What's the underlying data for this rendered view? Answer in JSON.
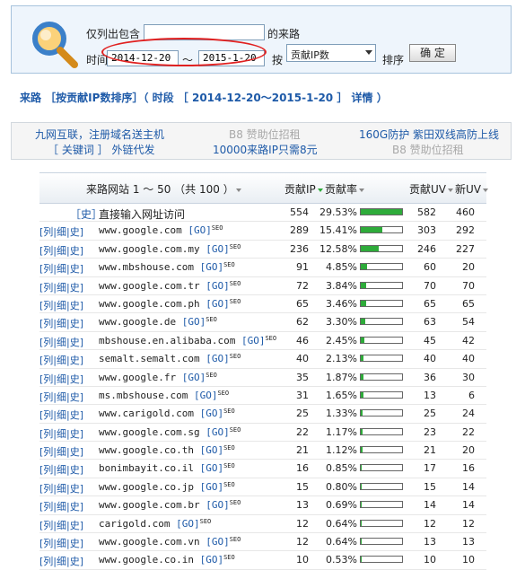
{
  "filter": {
    "contains_label": "仅列出包含",
    "contains_value": "",
    "source_suffix": "的来路",
    "time_label": "时间",
    "start_date": "2014-12-20",
    "range_sep": "～",
    "end_date": "2015-1-20",
    "by_label": "按",
    "sort_select": "贡献IP数",
    "sort_label": "排序",
    "ok_button": "确 定"
  },
  "heading": {
    "prefix": "来路 ［按贡献IP数排序］（ 时段 ［ 2014-12-20～2015-1-20 ］",
    "detail_link": "详情",
    "suffix": "）"
  },
  "ads": {
    "a1": "九网互联，注册域名送主机",
    "a2": "［ 关键词 ］ 外链代发",
    "a3": "B8 赞助位招租",
    "a4": "10000来路IP只需8元",
    "a5": "160G防护 紫田双线高防上线",
    "a6": "B8 赞助位招租"
  },
  "table": {
    "header": {
      "site": "来路网站 1 ～ 50 （共 100 ）",
      "ip": "贡献IP",
      "ip_rate": "贡献率",
      "uv": "贡献UV",
      "new_uv": "新UV"
    },
    "first_row": {
      "link": "［史］",
      "site": "直接输入网址访问",
      "ip": "554",
      "rate": "29.53%",
      "uv": "582",
      "new_uv": "460",
      "fill": 1.0
    },
    "rows": [
      {
        "links": "[列|细|史]",
        "site": "www.google.com",
        "go": "[GO]",
        "seo": "SEO",
        "ip": "289",
        "rate": "15.41%",
        "uv": "303",
        "new_uv": "292",
        "fill": 0.52
      },
      {
        "links": "[列|细|史]",
        "site": "www.google.com.my",
        "go": "[GO]",
        "seo": "SEO",
        "ip": "236",
        "rate": "12.58%",
        "uv": "246",
        "new_uv": "227",
        "fill": 0.43
      },
      {
        "links": "[列|细|史]",
        "site": "www.mbshouse.com",
        "go": "[GO]",
        "seo": "SEO",
        "ip": "91",
        "rate": "4.85%",
        "uv": "60",
        "new_uv": "20",
        "fill": 0.16
      },
      {
        "links": "[列|细|史]",
        "site": "www.google.com.tr",
        "go": "[GO]",
        "seo": "SEO",
        "ip": "72",
        "rate": "3.84%",
        "uv": "70",
        "new_uv": "70",
        "fill": 0.13
      },
      {
        "links": "[列|细|史]",
        "site": "www.google.com.ph",
        "go": "[GO]",
        "seo": "SEO",
        "ip": "65",
        "rate": "3.46%",
        "uv": "65",
        "new_uv": "65",
        "fill": 0.12
      },
      {
        "links": "[列|细|史]",
        "site": "www.google.de",
        "go": "[GO]",
        "seo": "SEO",
        "ip": "62",
        "rate": "3.30%",
        "uv": "63",
        "new_uv": "54",
        "fill": 0.11
      },
      {
        "links": "[列|细|史]",
        "site": "mbshouse.en.alibaba.com",
        "go": "[GO]",
        "seo": "SEO",
        "ip": "46",
        "rate": "2.45%",
        "uv": "45",
        "new_uv": "42",
        "fill": 0.08
      },
      {
        "links": "[列|细|史]",
        "site": "semalt.semalt.com",
        "go": "[GO]",
        "seo": "SEO",
        "ip": "40",
        "rate": "2.13%",
        "uv": "40",
        "new_uv": "40",
        "fill": 0.07
      },
      {
        "links": "[列|细|史]",
        "site": "www.google.fr",
        "go": "[GO]",
        "seo": "SEO",
        "ip": "35",
        "rate": "1.87%",
        "uv": "36",
        "new_uv": "30",
        "fill": 0.06
      },
      {
        "links": "[列|细|史]",
        "site": "ms.mbshouse.com",
        "go": "[GO]",
        "seo": "SEO",
        "ip": "31",
        "rate": "1.65%",
        "uv": "13",
        "new_uv": "6",
        "fill": 0.06
      },
      {
        "links": "[列|细|史]",
        "site": "www.carigold.com",
        "go": "[GO]",
        "seo": "SEO",
        "ip": "25",
        "rate": "1.33%",
        "uv": "25",
        "new_uv": "24",
        "fill": 0.05
      },
      {
        "links": "[列|细|史]",
        "site": "www.google.com.sg",
        "go": "[GO]",
        "seo": "SEO",
        "ip": "22",
        "rate": "1.17%",
        "uv": "23",
        "new_uv": "22",
        "fill": 0.04
      },
      {
        "links": "[列|细|史]",
        "site": "www.google.co.th",
        "go": "[GO]",
        "seo": "SEO",
        "ip": "21",
        "rate": "1.12%",
        "uv": "21",
        "new_uv": "20",
        "fill": 0.04
      },
      {
        "links": "[列|细|史]",
        "site": "bonimbayit.co.il",
        "go": "[GO]",
        "seo": "SEO",
        "ip": "16",
        "rate": "0.85%",
        "uv": "17",
        "new_uv": "16",
        "fill": 0.03
      },
      {
        "links": "[列|细|史]",
        "site": "www.google.co.jp",
        "go": "[GO]",
        "seo": "SEO",
        "ip": "15",
        "rate": "0.80%",
        "uv": "15",
        "new_uv": "14",
        "fill": 0.03
      },
      {
        "links": "[列|细|史]",
        "site": "www.google.com.br",
        "go": "[GO]",
        "seo": "SEO",
        "ip": "13",
        "rate": "0.69%",
        "uv": "14",
        "new_uv": "14",
        "fill": 0.02
      },
      {
        "links": "[列|细|史]",
        "site": "carigold.com",
        "go": "[GO]",
        "seo": "SEO",
        "ip": "12",
        "rate": "0.64%",
        "uv": "12",
        "new_uv": "12",
        "fill": 0.02
      },
      {
        "links": "[列|细|史]",
        "site": "www.google.com.vn",
        "go": "[GO]",
        "seo": "SEO",
        "ip": "12",
        "rate": "0.64%",
        "uv": "13",
        "new_uv": "13",
        "fill": 0.02
      },
      {
        "links": "[列|细|史]",
        "site": "www.google.co.in",
        "go": "[GO]",
        "seo": "SEO",
        "ip": "10",
        "rate": "0.53%",
        "uv": "10",
        "new_uv": "10",
        "fill": 0.02
      }
    ]
  },
  "colors": {
    "link": "#1e5aa8",
    "bar": "#2eab3a",
    "highlight_ring": "#e02020"
  },
  "icons": {
    "search": "magnifier-icon"
  }
}
